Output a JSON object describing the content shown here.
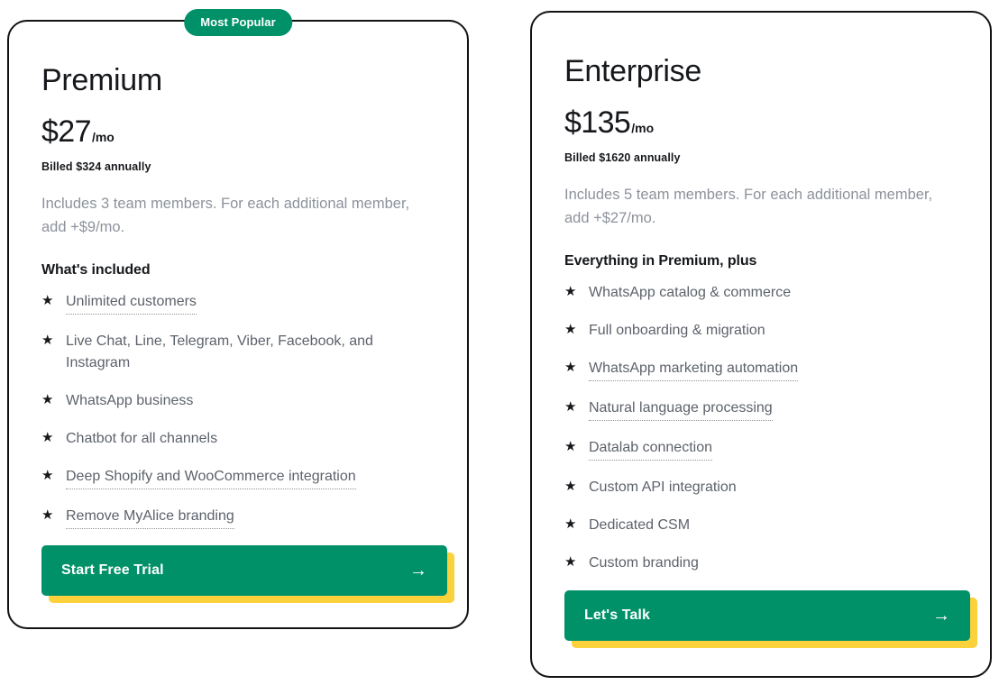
{
  "colors": {
    "brand_green": "#009168",
    "accent_yellow": "#fbd13c",
    "card_shadow_cream": "#fdf4d2",
    "card_border": "#111214",
    "heading": "#16181c",
    "muted_text": "#8d929b",
    "feature_text": "#5d626b"
  },
  "plans": [
    {
      "badge": "Most Popular",
      "name": "Premium",
      "price_amount": "$27",
      "price_period": "/mo",
      "billed": "Billed $324 annually",
      "members_note": "Includes 3 team members. For each additional member, add +$9/mo.",
      "included_title": "What's included",
      "features": [
        {
          "label": "Unlimited customers",
          "tooltip": true
        },
        {
          "label": "Live Chat, Line, Telegram, Viber, Facebook, and Instagram",
          "tooltip": false
        },
        {
          "label": "WhatsApp business",
          "tooltip": false
        },
        {
          "label": "Chatbot for all channels",
          "tooltip": false
        },
        {
          "label": "Deep Shopify and WooCommerce integration",
          "tooltip": true
        },
        {
          "label": "Remove MyAlice branding",
          "tooltip": true
        }
      ],
      "cta_label": "Start Free Trial",
      "cta_arrow": "→"
    },
    {
      "badge": null,
      "name": "Enterprise",
      "price_amount": "$135",
      "price_period": "/mo",
      "billed": "Billed $1620 annually",
      "members_note": "Includes 5 team members. For each additional member, add +$27/mo.",
      "included_title": "Everything in Premium, plus",
      "features": [
        {
          "label": "WhatsApp catalog & commerce",
          "tooltip": false
        },
        {
          "label": "Full onboarding & migration",
          "tooltip": false
        },
        {
          "label": "WhatsApp marketing automation",
          "tooltip": true
        },
        {
          "label": "Natural language processing",
          "tooltip": true
        },
        {
          "label": "Datalab connection",
          "tooltip": true
        },
        {
          "label": "Custom API integration",
          "tooltip": false
        },
        {
          "label": "Dedicated CSM",
          "tooltip": false
        },
        {
          "label": "Custom branding",
          "tooltip": false
        }
      ],
      "cta_label": "Let's Talk",
      "cta_arrow": "→"
    }
  ],
  "icons": {
    "star_bullet": "★"
  }
}
